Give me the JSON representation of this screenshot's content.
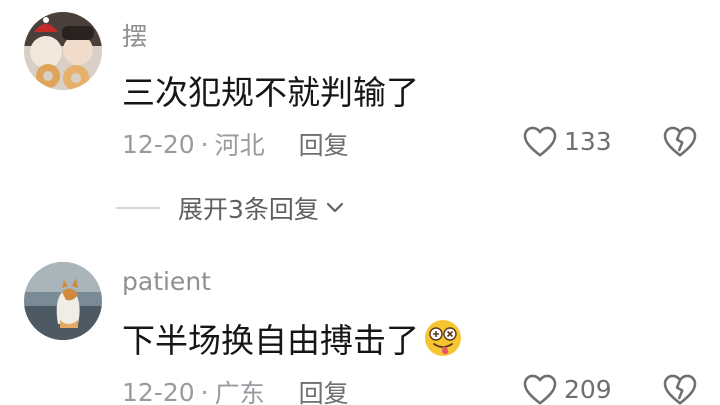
{
  "comments": [
    {
      "username": "摆",
      "content": "三次犯规不就判输了",
      "date": "12-20",
      "location": "河北",
      "separator": "·",
      "reply_label": "回复",
      "like_count": "133"
    },
    {
      "username": "patient",
      "content": "下半场换自由搏击了",
      "emoji": "dizzy-tongue-face-emoji",
      "date": "12-20",
      "location": "广东",
      "separator": "·",
      "reply_label": "回复",
      "like_count": "209"
    }
  ],
  "expand_replies": {
    "label": "展开3条回复",
    "icon": "chevron-down-icon"
  },
  "colors": {
    "text_primary": "#161616",
    "text_secondary": "#9a9aa0",
    "icon_gray": "#6e6e73"
  }
}
